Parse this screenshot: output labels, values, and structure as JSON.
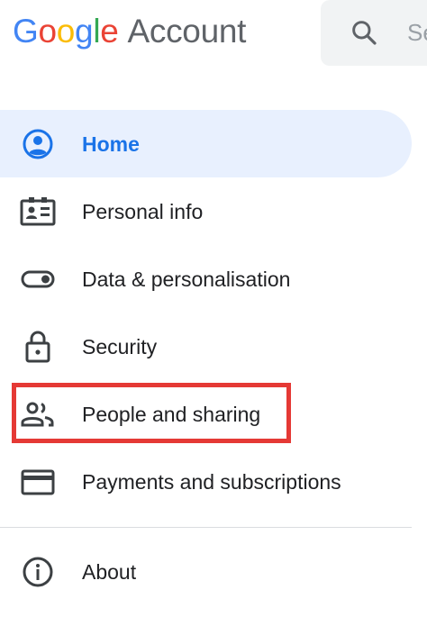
{
  "header": {
    "logo": {
      "letters": [
        {
          "char": "G",
          "color": "#4285F4"
        },
        {
          "char": "o",
          "color": "#EA4335"
        },
        {
          "char": "o",
          "color": "#FBBC05"
        },
        {
          "char": "g",
          "color": "#4285F4"
        },
        {
          "char": "l",
          "color": "#34A853"
        },
        {
          "char": "e",
          "color": "#EA4335"
        }
      ],
      "product": "Account"
    },
    "search": {
      "icon": "search-icon",
      "placeholder": "Se"
    }
  },
  "nav": {
    "items": [
      {
        "label": "Home",
        "icon": "account-circle-icon",
        "active": true
      },
      {
        "label": "Personal info",
        "icon": "id-card-icon",
        "active": false
      },
      {
        "label": "Data & personalisation",
        "icon": "toggle-icon",
        "active": false
      },
      {
        "label": "Security",
        "icon": "lock-icon",
        "active": false
      },
      {
        "label": "People and sharing",
        "icon": "people-icon",
        "active": false,
        "highlighted": true
      },
      {
        "label": "Payments and subscriptions",
        "icon": "credit-card-icon",
        "active": false
      }
    ],
    "about": {
      "label": "About",
      "icon": "info-icon"
    }
  },
  "colors": {
    "accent": "#1a73e8",
    "active_bg": "#e8f0fe",
    "highlight_border": "#e53935",
    "icon": "#5f6368"
  }
}
